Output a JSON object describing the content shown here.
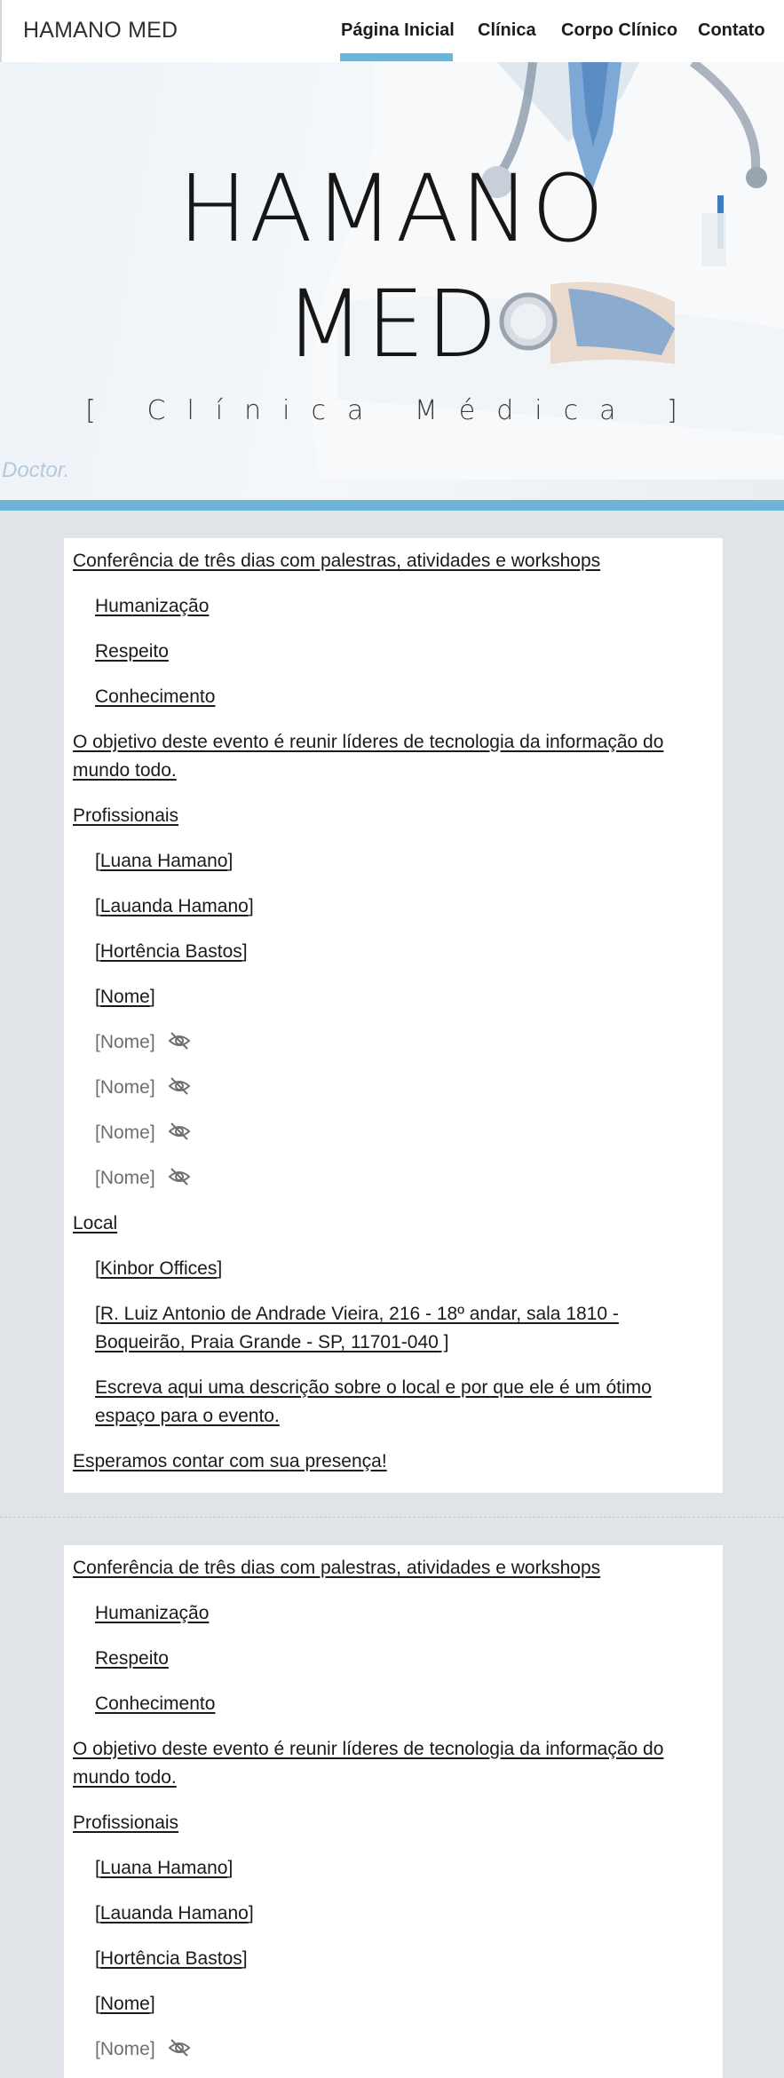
{
  "header": {
    "brand": "HAMANO MED",
    "nav": [
      {
        "label": "Página Inicial",
        "active": true
      },
      {
        "label": "Clínica",
        "active": false
      },
      {
        "label": "Corpo Clínico",
        "active": false
      },
      {
        "label": "Contato",
        "active": false
      }
    ],
    "accent_color": "#6fb3d6"
  },
  "hero": {
    "title_line1": "HAMANO",
    "title_line2": "MED",
    "subtitle": "[ Clínica Médica ]",
    "watermark": "Doctor."
  },
  "sections": [
    {
      "intro": "Conferência de três dias com palestras, atividades e workshops",
      "values": [
        "Humanização",
        "Respeito",
        "Conhecimento"
      ],
      "objective": "O objetivo deste evento é reunir líderes de tecnologia da informação do mundo todo.",
      "professionals_heading": "Profissionais",
      "professionals": [
        "Luana Hamano",
        "Lauanda Hamano",
        "Hortência Bastos",
        "Nome"
      ],
      "hidden_professionals": [
        "[Nome]",
        "[Nome]",
        "[Nome]",
        "[Nome]"
      ],
      "local_heading": "Local",
      "venue": "Kinbor Offices",
      "address": "R. Luiz Antonio de Andrade Vieira, 216 - 18º andar, sala 1810 - Boqueirão, Praia Grande - SP, 11701-040",
      "venue_description": "Escreva aqui uma descrição sobre o local e por que ele é um ótimo espaço para o evento.",
      "closing": "Esperamos contar com sua presença!"
    },
    {
      "intro": "Conferência de três dias com palestras, atividades e workshops",
      "values": [
        "Humanização",
        "Respeito",
        "Conhecimento"
      ],
      "objective": "O objetivo deste evento é reunir líderes de tecnologia da informação do mundo todo.",
      "professionals_heading": "Profissionais",
      "professionals": [
        "Luana Hamano",
        "Lauanda Hamano",
        "Hortência Bastos",
        "Nome"
      ],
      "hidden_professionals": [
        "[Nome]"
      ]
    }
  ]
}
